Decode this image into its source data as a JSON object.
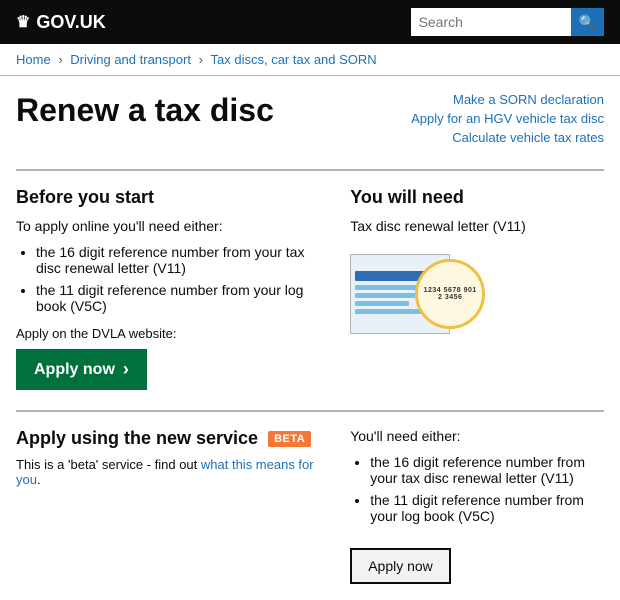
{
  "header": {
    "logo_text": "GOV.UK",
    "crown_symbol": "♛",
    "search_placeholder": "Search",
    "search_button_label": "🔍"
  },
  "breadcrumb": {
    "items": [
      {
        "label": "Home",
        "href": "#"
      },
      {
        "label": "Driving and transport",
        "href": "#"
      },
      {
        "label": "Tax discs, car tax and SORN",
        "href": "#"
      }
    ]
  },
  "page": {
    "title": "Renew a tax disc",
    "related_links": [
      {
        "label": "Make a SORN declaration",
        "href": "#"
      },
      {
        "label": "Apply for an HGV vehicle tax disc",
        "href": "#"
      },
      {
        "label": "Calculate vehicle tax rates",
        "href": "#"
      }
    ]
  },
  "before_start": {
    "heading": "Before you start",
    "intro": "To apply online you'll need either:",
    "bullets": [
      "the 16 digit reference number from your tax disc renewal letter (V11)",
      "the 11 digit reference number from your log book (V5C)"
    ],
    "dvla_label": "Apply on the DVLA website:",
    "apply_btn_label": "Apply now",
    "apply_btn_arrow": "›"
  },
  "you_will_need": {
    "heading": "You will need",
    "text": "Tax disc renewal letter (V11)",
    "disc_number": "1234 5678 9012 3456"
  },
  "beta_section": {
    "heading": "Apply using the new service",
    "badge": "BETA",
    "description": "This is a 'beta' service - find out",
    "link_text": "what this means for you",
    "right_intro": "You'll need either:",
    "bullets": [
      "the 16 digit reference number from your tax disc renewal letter (V11)",
      "the 11 digit reference number from your log book (V5C)"
    ],
    "apply_btn_label": "Apply now"
  }
}
